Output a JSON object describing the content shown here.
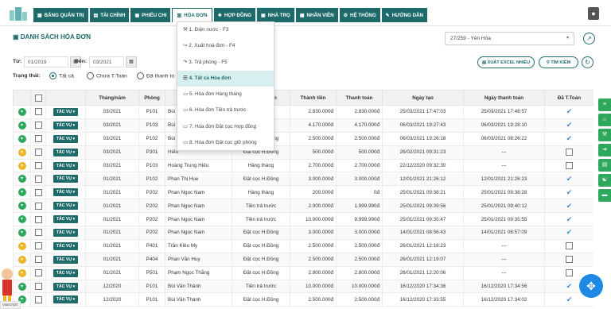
{
  "nav": [
    {
      "icon": "grid-icon",
      "label": "BẢNG QUẢN TRỊ",
      "active": false
    },
    {
      "icon": "chart-icon",
      "label": "TÀI CHÍNH",
      "active": false
    },
    {
      "icon": "receipt-icon",
      "label": "PHIẾU CHI",
      "active": false
    },
    {
      "icon": "invoice-icon",
      "label": "HÓA ĐƠN",
      "active": true
    },
    {
      "icon": "contract-icon",
      "label": "HỢP ĐỒNG",
      "active": false
    },
    {
      "icon": "room-icon",
      "label": "NHÀ TRỌ",
      "active": false
    },
    {
      "icon": "staff-icon",
      "label": "NHÂN VIÊN",
      "active": false
    },
    {
      "icon": "settings-icon",
      "label": "HỆ THỐNG",
      "active": false
    },
    {
      "icon": "guide-icon",
      "label": "HƯỚNG DẪN",
      "active": false
    }
  ],
  "page_title": "DANH SÁCH HÓA ĐƠN",
  "branch_select": "27/259 - Yên Hòa",
  "filters": {
    "from_label": "Từ:",
    "from_value": "01/2019",
    "to_label": "Đến:",
    "to_value": "03/2021",
    "status_label": "Trạng thái:",
    "status_options": [
      "Tất cả",
      "Chưa T.Toán",
      "Đã thanh to"
    ],
    "status_selected": "Tất cả"
  },
  "buttons": {
    "export": "XUẤT EXCEL NHIỀU",
    "search": "TÌM KIẾM"
  },
  "menu": [
    {
      "label": "1. Điện nước - F3",
      "icon": "wrench-icon",
      "highlight": false
    },
    {
      "label": "2. Xuất hoá đơn - F4",
      "icon": "export-icon",
      "highlight": false
    },
    {
      "label": "3. Trả phòng - F5",
      "icon": "arrow-icon",
      "highlight": false
    },
    {
      "label": "4. Tất cả Hóa đơn",
      "icon": "list-icon",
      "highlight": true
    },
    {
      "label": "5. Hóa đơn Hàng tháng",
      "icon": "doc-icon",
      "highlight": false
    },
    {
      "label": "6. Hóa đơn Tiền trả trước",
      "icon": "doc-icon",
      "highlight": false
    },
    {
      "label": "7. Hóa đơn Đặt cọc Hợp đồng",
      "icon": "doc-icon",
      "highlight": false
    },
    {
      "label": "8. Hóa đơn Đặt cọc giữ phòng",
      "icon": "doc-icon",
      "highlight": false
    }
  ],
  "table": {
    "headers": [
      "",
      "",
      "",
      "Tháng/năm",
      "Phòng",
      "Người",
      "Loại hóa đơn",
      "Thành tiền",
      "Thanh toán",
      "Ngày tạo",
      "Ngày thanh toán",
      "Đã T.Toán"
    ],
    "action_label": "TÁC VỤ",
    "rows": [
      {
        "s": "g",
        "m": "03/2021",
        "p": "P101",
        "n": "Bùi",
        "t": "Hàng tháng",
        "tt": "2.830.000đ",
        "pay": "2.830.000đ",
        "c": "25/03/2021 17:47:03",
        "d": "25/03/2021 17:48:57",
        "paid": true
      },
      {
        "s": "g",
        "m": "03/2021",
        "p": "P103",
        "n": "Bùi",
        "t": "Hàng tháng",
        "tt": "4.170.000đ",
        "pay": "4.170.000đ",
        "c": "06/03/2021 19:27:43",
        "d": "06/03/2021 19:28:10",
        "paid": true
      },
      {
        "s": "g",
        "m": "03/2021",
        "p": "P102",
        "n": "Bùi",
        "t": "Đặt cọc H.Đồng",
        "tt": "2.500.000đ",
        "pay": "2.500.000đ",
        "c": "06/03/2021 19:26:18",
        "d": "06/03/2021 08:26:22",
        "paid": true
      },
      {
        "s": "y",
        "m": "03/2021",
        "p": "P301",
        "n": "Hiếu",
        "t": "Đặt cọc H.Đồng",
        "tt": "500.000đ",
        "pay": "500.000đ",
        "c": "26/02/2021 09:31:23",
        "d": "---",
        "paid": false
      },
      {
        "s": "y",
        "m": "03/2021",
        "p": "P103",
        "n": "Hoàng Trung Hiếu",
        "t": "Hàng tháng",
        "tt": "2.700.000đ",
        "pay": "2.700.000đ",
        "c": "22/12/2020 09:32:30",
        "d": "---",
        "paid": false
      },
      {
        "s": "g",
        "m": "01/2021",
        "p": "P102",
        "n": "Phan Thị Hue",
        "t": "Đặt cọc H.Đồng",
        "tt": "3.000.000đ",
        "pay": "3.000.000đ",
        "c": "12/01/2021 21:26:12",
        "d": "12/01/2021 21:26:23",
        "paid": true
      },
      {
        "s": "g",
        "m": "01/2021",
        "p": "P202",
        "n": "Phan Ngọc Nam",
        "t": "Hàng tháng",
        "tt": "200.000đ",
        "pay": "0đ",
        "c": "25/01/2021 09:38:21",
        "d": "25/01/2021 09:38:28",
        "paid": true
      },
      {
        "s": "g",
        "m": "01/2021",
        "p": "P202",
        "n": "Phan Ngọc Nam",
        "t": "Tiền trả trước",
        "tt": "2.000.000đ",
        "pay": "1.999.990đ",
        "c": "25/01/2021 09:39:56",
        "d": "25/01/2021 09:40:12",
        "paid": true
      },
      {
        "s": "g",
        "m": "01/2021",
        "p": "P202",
        "n": "Phan Ngọc Nam",
        "t": "Tiền trả trước",
        "tt": "10.000.000đ",
        "pay": "9.999.990đ",
        "c": "25/01/2021 09:35:47",
        "d": "25/01/2021 09:35:55",
        "paid": true
      },
      {
        "s": "g",
        "m": "01/2021",
        "p": "P202",
        "n": "Phan Ngọc Nam",
        "t": "Đặt cọc H.Đồng",
        "tt": "3.000.000đ",
        "pay": "3.000.000đ",
        "c": "14/01/2021 08:56:43",
        "d": "14/01/2021 08:57:09",
        "paid": true
      },
      {
        "s": "y",
        "m": "01/2021",
        "p": "P401",
        "n": "Trần Kiều My",
        "t": "Đặt cọc H.Đồng",
        "tt": "2.500.000đ",
        "pay": "2.500.000đ",
        "c": "26/01/2021 12:18:23",
        "d": "---",
        "paid": false
      },
      {
        "s": "y",
        "m": "01/2021",
        "p": "P404",
        "n": "Phan Văn Huy",
        "t": "Đặt cọc H.Đồng",
        "tt": "2.500.000đ",
        "pay": "2.500.000đ",
        "c": "26/01/2021 12:19:07",
        "d": "---",
        "paid": false
      },
      {
        "s": "y",
        "m": "01/2021",
        "p": "P501",
        "n": "Phạm Ngọc Thắng",
        "t": "Đặt cọc H.Đồng",
        "tt": "2.800.000đ",
        "pay": "2.800.000đ",
        "c": "26/01/2021 12:20:06",
        "d": "---",
        "paid": false
      },
      {
        "s": "g",
        "m": "12/2020",
        "p": "P101",
        "n": "Bùi Văn Thành",
        "t": "Tiền trả trước",
        "tt": "10.000.000đ",
        "pay": "10.000.000đ",
        "c": "16/12/2020 17:34:36",
        "d": "16/12/2020 17:34:56",
        "paid": true
      },
      {
        "s": "g",
        "m": "12/2020",
        "p": "P101",
        "n": "Bùi Văn Thành",
        "t": "Đặt cọc H.Đồng",
        "tt": "2.500.000đ",
        "pay": "2.500.000đ",
        "c": "16/12/2020 17:33:55",
        "d": "16/12/2020 17:34:02",
        "paid": true
      }
    ]
  },
  "status_url": "vascript:"
}
